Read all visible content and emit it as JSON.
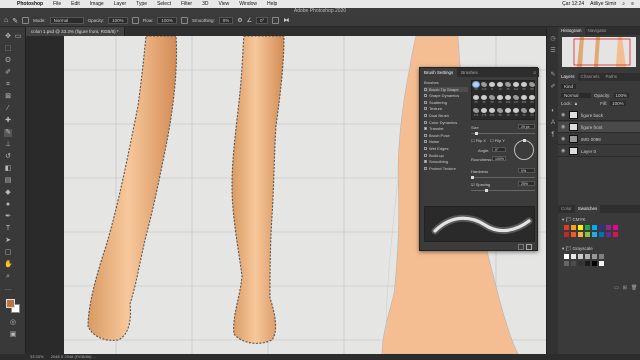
{
  "menubar": {
    "app_name": "Photoshop",
    "items": [
      "File",
      "Edit",
      "Image",
      "Layer",
      "Type",
      "Select",
      "Filter",
      "3D",
      "View",
      "Window",
      "Help"
    ],
    "clock": "Çar 12:24",
    "user": "Atiliye Simir"
  },
  "window_title": "Adobe Photoshop 2020",
  "options_bar": {
    "mode_label": "Mode:",
    "mode_value": "Normal",
    "opacity_label": "Opacity:",
    "opacity_value": "100%",
    "flow_label": "Flow:",
    "flow_value": "100%",
    "smoothing_label": "Smoothing:",
    "smoothing_value": "0%",
    "angle_value": "0°"
  },
  "document_tab": "colon 1.psd @ 33.3% (figure front, RGB/8) *",
  "status_bar": {
    "zoom": "33.33%",
    "doc_info": "2048 X 2048 (RGB/8#) ..."
  },
  "brush_panel": {
    "tabs": [
      "Brush Settings",
      "Brushes"
    ],
    "options": [
      {
        "label": "Brushes",
        "checked": false,
        "highlight": false
      },
      {
        "label": "Brush Tip Shape",
        "checked": false,
        "highlight": true
      },
      {
        "label": "Shape Dynamics",
        "checked": false,
        "highlight": false
      },
      {
        "label": "Scattering",
        "checked": false,
        "highlight": false
      },
      {
        "label": "Texture",
        "checked": false,
        "highlight": false
      },
      {
        "label": "Dual Brush",
        "checked": false,
        "highlight": false
      },
      {
        "label": "Color Dynamics",
        "checked": false,
        "highlight": false
      },
      {
        "label": "Transfer",
        "checked": true,
        "highlight": false
      },
      {
        "label": "Brush Pose",
        "checked": false,
        "highlight": false
      },
      {
        "label": "Noise",
        "checked": false,
        "highlight": false
      },
      {
        "label": "Wet Edges",
        "checked": false,
        "highlight": false
      },
      {
        "label": "Build-up",
        "checked": false,
        "highlight": false
      },
      {
        "label": "Smoothing",
        "checked": true,
        "highlight": false
      },
      {
        "label": "Protect Texture",
        "checked": false,
        "highlight": false
      }
    ],
    "tip_sizes": [
      "30",
      "123",
      "8",
      "10",
      "25",
      "112",
      "60",
      "50",
      "25",
      "30",
      "50",
      "60",
      "100",
      "127",
      "284",
      "80",
      "174",
      "175",
      "306",
      "50",
      "16",
      "18",
      "30",
      "24"
    ],
    "size_label": "Size",
    "size_value": "29 px",
    "flip_x": "Flip X",
    "flip_y": "Flip Y",
    "angle_label": "Angle:",
    "angle_value": "0°",
    "roundness_label": "Roundness:",
    "roundness_value": "100%",
    "hardness_label": "Hardness",
    "hardness_value": "0%",
    "spacing_label": "Spacing",
    "spacing_value": "25%"
  },
  "right_panels": {
    "top_tabs": [
      "Histogram",
      "Navigator"
    ],
    "layer_tabs": [
      "Layers",
      "Channels",
      "Paths"
    ],
    "kind_label": "Kind",
    "blend_mode": "Normal",
    "opacity_label": "Opacity:",
    "opacity_value": "100%",
    "lock_label": "Lock:",
    "fill_label": "Fill:",
    "fill_value": "100%",
    "layers": [
      {
        "name": "figure back",
        "selected": false
      },
      {
        "name": "figure front",
        "selected": true
      },
      {
        "name": "IMG 0098",
        "selected": false
      },
      {
        "name": "Layer 0",
        "selected": false
      }
    ],
    "swatch_tabs": [
      "Color",
      "Swatches"
    ],
    "swatch_group_1": "CMYK",
    "swatch_group_2": "Grayscale",
    "cmyk_colors": [
      "#e8382d",
      "#f7a21b",
      "#fff200",
      "#22a84a",
      "#00aeef",
      "#2e3192",
      "#92278f",
      "#ec008c",
      "#c1272d",
      "#f15a24",
      "#fbb03b",
      "#8cc63f",
      "#29abe2",
      "#0071bc",
      "#662d91",
      "#d4145a"
    ],
    "gray_colors": [
      "#ffffff",
      "#e6e6e6",
      "#cccccc",
      "#b3b3b3",
      "#999999",
      "#808080",
      "#666666",
      "#4d4d4d",
      "#333333",
      "#1a1a1a",
      "#000000",
      "#f2f2f2"
    ]
  }
}
